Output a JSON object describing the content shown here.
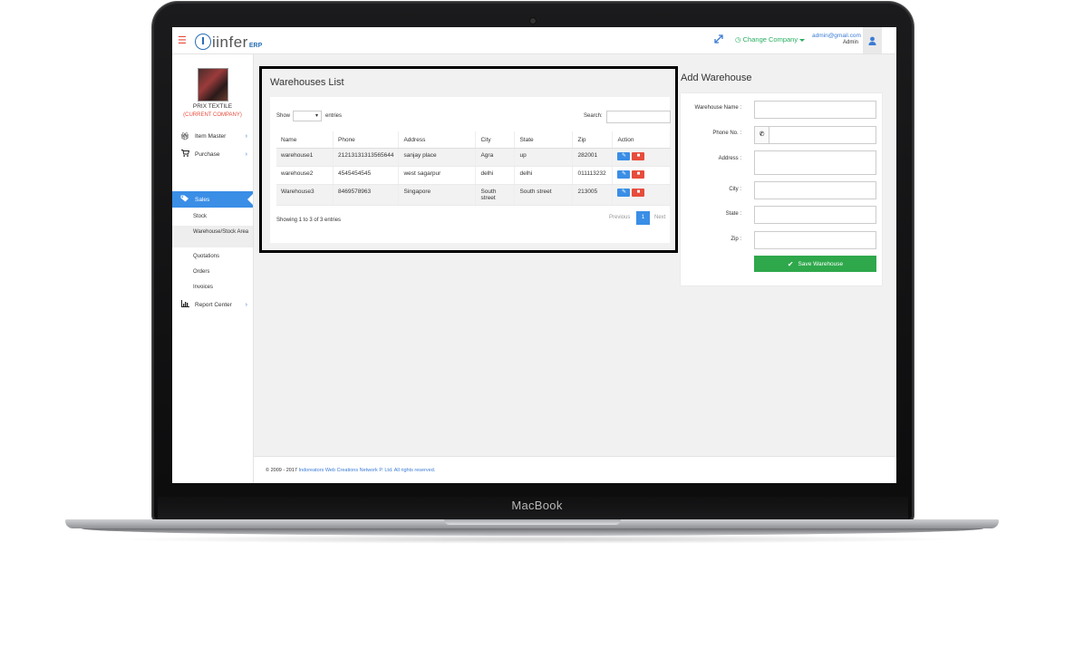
{
  "device": {
    "brand": "MacBook"
  },
  "header": {
    "logo_text": "iinfer",
    "logo_suffix": "ERP",
    "change_company": "Change Company",
    "user_email": "admin@gmail.com",
    "user_role": "Admin"
  },
  "sidebar": {
    "company_name": "PRIX TEXTILE",
    "company_tag": "(CURRENT COMPANY)",
    "items": [
      {
        "label": "Item Master",
        "icon": "gift-icon"
      },
      {
        "label": "Purchase",
        "icon": "cart-icon"
      },
      {
        "label": "Sales",
        "icon": "tags-icon",
        "active": true
      },
      {
        "label": "Report Center",
        "icon": "bar-chart-icon"
      }
    ],
    "sales_subitems": [
      "Stock",
      "Warehouse/Stock Area",
      "Quotations",
      "Orders",
      "Invoices"
    ]
  },
  "list": {
    "title": "Warehouses List",
    "show_label": "Show",
    "entries_label": "entries",
    "search_label": "Search:",
    "columns": [
      "Name",
      "Phone",
      "Address",
      "City",
      "State",
      "Zip",
      "Action"
    ],
    "rows": [
      [
        "warehouse1",
        "21213131313565644",
        "sanjay place",
        "Agra",
        "up",
        "282001"
      ],
      [
        "warehouse2",
        "4545454545",
        "west sagarpur",
        "delhi",
        "delhi",
        "011113232"
      ],
      [
        "Warehouse3",
        "8469578963",
        "Singapore",
        "South street",
        "South street",
        "213005"
      ]
    ],
    "showing": "Showing 1 to 3 of 3 entries",
    "pagination": {
      "previous": "Previous",
      "page": "1",
      "next": "Next"
    }
  },
  "form": {
    "title": "Add Warehouse",
    "labels": {
      "name": "Warehouse Name :",
      "phone": "Phone No. :",
      "address": "Address :",
      "city": "City :",
      "state": "State :",
      "zip": "Zip :"
    },
    "save_label": "Save Warehouse"
  },
  "footer": {
    "prefix": "© 2009 - 2017",
    "company": "Indoreators Web Creations Network P. Ltd.",
    "suffix": "All rights reserved."
  },
  "colors": {
    "accent": "#3a8ee6",
    "danger": "#e74c3c",
    "success": "#2ea84b",
    "link": "#3a7bd5"
  }
}
